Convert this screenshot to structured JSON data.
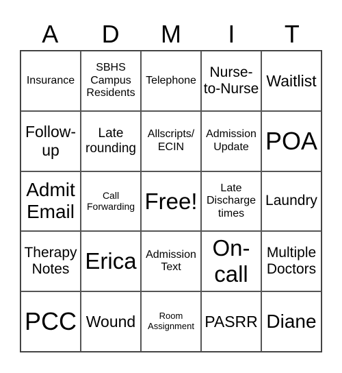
{
  "header": {
    "letters": [
      "A",
      "D",
      "M",
      "I",
      "T"
    ]
  },
  "grid": {
    "rows": [
      [
        "Insurance",
        "SBHS Campus Residents",
        "Telephone",
        "Nurse-to-Nurse",
        "Waitlist"
      ],
      [
        "Follow-up",
        "Late rounding",
        "Allscripts/ ECIN",
        "Admission Update",
        "POA"
      ],
      [
        "Admit Email",
        "Call Forwarding",
        "Free!",
        "Late Discharge times",
        "Laundry"
      ],
      [
        "Therapy Notes",
        "Erica",
        "Admission Text",
        "On-call",
        "Multiple Doctors"
      ],
      [
        "PCC",
        "Wound",
        "Room Assignment",
        "PASRR",
        "Diane"
      ]
    ]
  }
}
